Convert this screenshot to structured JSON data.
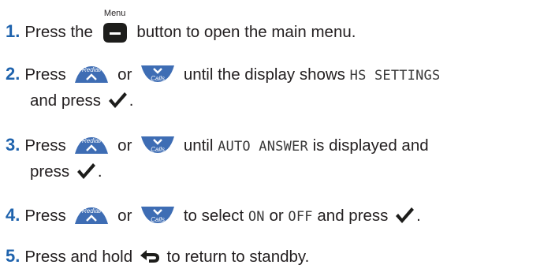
{
  "steps": [
    {
      "number": "1.",
      "t1": "Press the",
      "t2": "button to open the main menu."
    },
    {
      "number": "2.",
      "t1": "Press",
      "t2": "or",
      "t3": "until the display shows",
      "lcd": "HS SETTINGS",
      "t4": "and press",
      "t5": "."
    },
    {
      "number": "3.",
      "t1": "Press",
      "t2": "or",
      "t3": "until",
      "lcd": "AUTO ANSWER",
      "t4": "is displayed and",
      "t5": "press",
      "t6": "."
    },
    {
      "number": "4.",
      "t1": "Press",
      "t2": "or",
      "t3": "to select",
      "lcd1": "ON",
      "t4": "or",
      "lcd2": "OFF",
      "t5": "and press",
      "t6": "."
    },
    {
      "number": "5.",
      "t1": "Press and hold",
      "t2": "to return to standby."
    }
  ],
  "buttons": {
    "menu_label": "Menu",
    "up_label": "Redial/",
    "down_label": "Calls"
  },
  "icons": {
    "menu": "menu-button-icon",
    "up": "redial-up-button-icon",
    "down": "calls-down-button-icon",
    "confirm": "checkmark-icon",
    "back": "back-arrow-icon"
  },
  "colors": {
    "step_number": "#1f63ad",
    "button_dark": "#1d1d1b",
    "nav_button": "#3e6db4",
    "text": "#231f20"
  }
}
